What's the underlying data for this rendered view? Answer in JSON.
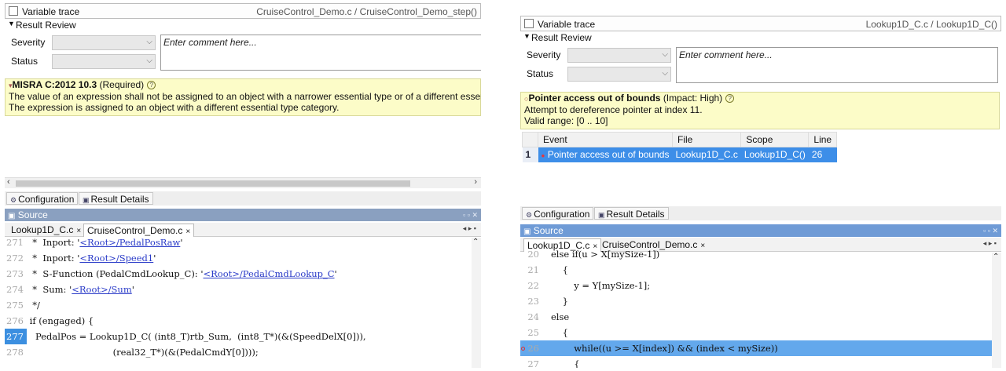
{
  "left": {
    "trace_label": "Variable trace",
    "trace_file": "CruiseControl_Demo.c / CruiseControl_Demo_step()",
    "review_label": "Result Review",
    "severity_label": "Severity",
    "status_label": "Status",
    "comment_placeholder": "Enter comment here...",
    "finding_title": "MISRA C:2012 10.3",
    "finding_tag": "(Required)",
    "finding_line1": "The value of an expression shall not be assigned to an object with a narrower essential type or of a different essenti",
    "finding_line2": "The expression is assigned to an object with a different essential type category.",
    "tab_config": "Configuration",
    "tab_details": "Result Details",
    "source_title": "Source",
    "file_tabs": [
      "Lookup1D_C.c",
      "CruiseControl_Demo.c"
    ],
    "code": [
      {
        "n": "271",
        "pre": "  *  Inport: '",
        "link": "<Root>/PedalPosRaw",
        "post": "'"
      },
      {
        "n": "272",
        "pre": "  *  Inport: '",
        "link": "<Root>/Speed1",
        "post": "'"
      },
      {
        "n": "273",
        "pre": "  *  S-Function (PedalCmdLookup_C): '",
        "link": "<Root>/PedalCmdLookup_C",
        "post": "'"
      },
      {
        "n": "274",
        "pre": "  *  Sum: '",
        "link": "<Root>/Sum",
        "post": "'"
      },
      {
        "n": "275",
        "pre": "  */",
        "link": "",
        "post": ""
      },
      {
        "n": "276",
        "pre": " if (engaged) {",
        "link": "",
        "post": ""
      },
      {
        "n": "277",
        "pre": "   PedalPos = Lookup1D_C( (int8_T)rtb_Sum,  (int8_T*)(&(SpeedDelX[0])),",
        "link": "",
        "post": ""
      },
      {
        "n": "278",
        "pre": "                              (real32_T*)(&(PedalCmdY[0])));",
        "link": "",
        "post": ""
      }
    ]
  },
  "right": {
    "trace_label": "Variable trace",
    "trace_file": "Lookup1D_C.c / Lookup1D_C()",
    "review_label": "Result Review",
    "severity_label": "Severity",
    "status_label": "Status",
    "comment_placeholder": "Enter comment here...",
    "finding_title": "Pointer access out of bounds",
    "finding_tag": "(Impact: High)",
    "finding_line1": "Attempt to dereference pointer at index 11.",
    "finding_line2": "Valid range: [0 .. 10]",
    "event_headers": [
      "Event",
      "File",
      "Scope",
      "Line"
    ],
    "event_row": {
      "num": "1",
      "event": "Pointer access out of bounds",
      "file": "Lookup1D_C.c",
      "scope": "Lookup1D_C()",
      "line": "26"
    },
    "tab_config": "Configuration",
    "tab_details": "Result Details",
    "source_title": "Source",
    "file_tabs": [
      "Lookup1D_C.c",
      "CruiseControl_Demo.c"
    ],
    "code": [
      {
        "n": "20",
        "text": "   else if(u > X[mySize-1])"
      },
      {
        "n": "21",
        "text": "       {"
      },
      {
        "n": "22",
        "text": "           y = Y[mySize-1];"
      },
      {
        "n": "23",
        "text": "       }"
      },
      {
        "n": "24",
        "text": "   else"
      },
      {
        "n": "25",
        "text": "       {"
      },
      {
        "n": "26",
        "text": "           while((u >= X[index]) && (index < mySize))"
      },
      {
        "n": "27",
        "text": "           {"
      }
    ]
  }
}
